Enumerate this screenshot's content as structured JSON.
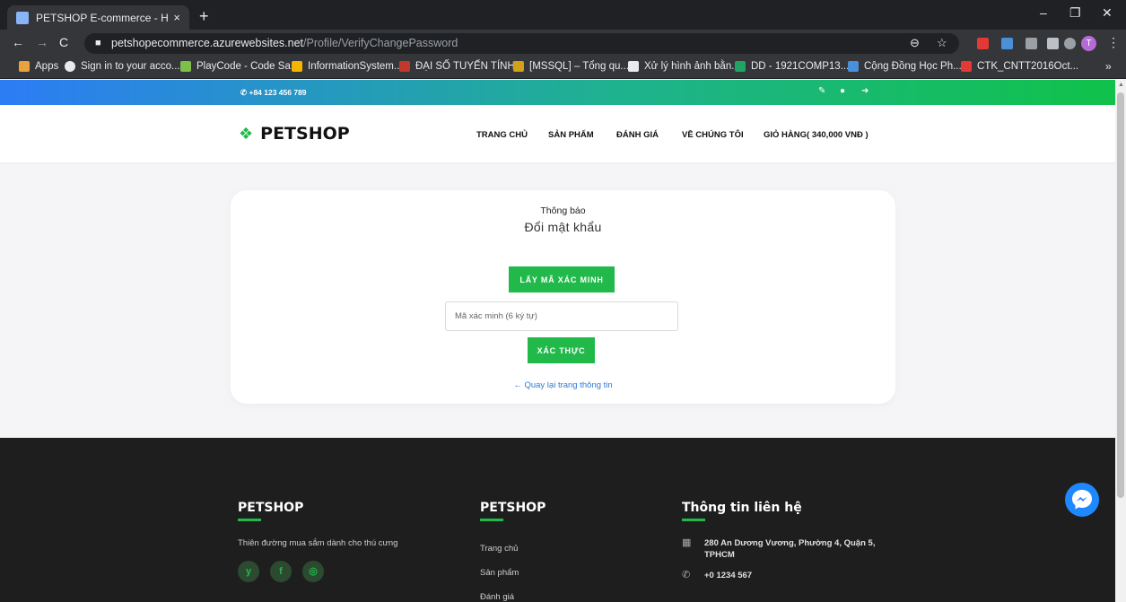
{
  "browser": {
    "tab_title": "PETSHOP E-commerce - HCMUE",
    "tab_close": "×",
    "new_tab": "+",
    "url_domain": "petshopecommerce.azurewebsites.net",
    "url_path": "/Profile/VerifyChangePassword",
    "profile_initial": "T",
    "window_controls": [
      "–",
      "❐",
      "✕"
    ],
    "bookmarks": [
      {
        "label": "Apps",
        "color": "#e8eaed"
      },
      {
        "label": "Sign in to your acco...",
        "color": "#e8eaed"
      },
      {
        "label": "PlayCode - Code Sa...",
        "color": "#7cc04b"
      },
      {
        "label": "InformationSystem...",
        "color": "#f4b400"
      },
      {
        "label": "ĐẠI SỐ TUYẾN TÍNH",
        "color": "#c0392b"
      },
      {
        "label": "[MSSQL] – Tổng qu...",
        "color": "#d4a017"
      },
      {
        "label": "Xử lý hình ảnh bằn...",
        "color": "#e8eaed"
      },
      {
        "label": "DD - 1921COMP13...",
        "color": "#1fa463"
      },
      {
        "label": "Cộng Đồng Học Ph...",
        "color": "#4a90d9"
      },
      {
        "label": "CTK_CNTT2016Oct...",
        "color": "#e53935"
      }
    ],
    "bookmarks_more": "»"
  },
  "topbar": {
    "phone": "+84 123 456 789"
  },
  "header": {
    "logo": "PETSHOP",
    "menu": [
      "TRANG CHỦ",
      "SẢN PHẨM",
      "ĐÁNH GIÁ",
      "VỀ CHÚNG TÔI",
      "GIỎ HÀNG( 340,000 VNĐ )"
    ]
  },
  "card": {
    "caption": "Thông báo",
    "heading": "Đổi mật khẩu",
    "get_code_button": "LẤY MÃ XÁC MINH",
    "code_placeholder": "Mã xác minh (6 ký tự)",
    "verify_button": "XÁC THỰC",
    "back_link": "← Quay lại trang thông tin"
  },
  "footer": {
    "col1": {
      "title": "PETSHOP",
      "tagline": "Thiên đường mua sắm dành cho thú cưng",
      "social": [
        "y",
        "f",
        "◎"
      ]
    },
    "col2": {
      "title": "PETSHOP",
      "links": [
        "Trang chủ",
        "Sản phẩm",
        "Đánh giá"
      ]
    },
    "col3": {
      "title": "Thông tin liên hệ",
      "address_line1": "280 An Dương Vương, Phường 4, Quận 5,",
      "address_line2": "TPHCM",
      "phone": "+0 1234 567"
    }
  },
  "colors": {
    "accent": "#20b94a",
    "link": "#2d7bd8",
    "footer_bg": "#1e1e1e"
  }
}
